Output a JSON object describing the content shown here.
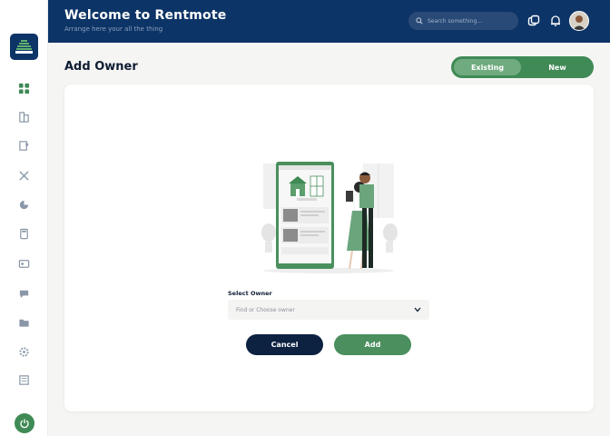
{
  "header": {
    "title": "Welcome to Rentmote",
    "subtitle": "Arrange here your all the thing",
    "search_placeholder": "Search something..."
  },
  "sidebar": {
    "items": [
      {
        "icon": "dashboard-icon"
      },
      {
        "icon": "building-icon"
      },
      {
        "icon": "document-icon"
      },
      {
        "icon": "tools-icon"
      },
      {
        "icon": "pie-chart-icon"
      },
      {
        "icon": "calculator-icon"
      },
      {
        "icon": "contact-card-icon"
      },
      {
        "icon": "chat-icon"
      },
      {
        "icon": "folder-icon"
      },
      {
        "icon": "settings-icon"
      },
      {
        "icon": "report-icon"
      }
    ]
  },
  "page": {
    "title": "Add Owner",
    "toggle": {
      "existing": "Existing",
      "new": "New",
      "selected": "Existing"
    }
  },
  "form": {
    "select_label": "Select Owner",
    "select_placeholder": "Find or Choose owner",
    "cancel_label": "Cancel",
    "add_label": "Add"
  },
  "colors": {
    "primary_navy": "#0d3466",
    "accent_green": "#3f8a55",
    "cancel_navy": "#0c2240"
  }
}
